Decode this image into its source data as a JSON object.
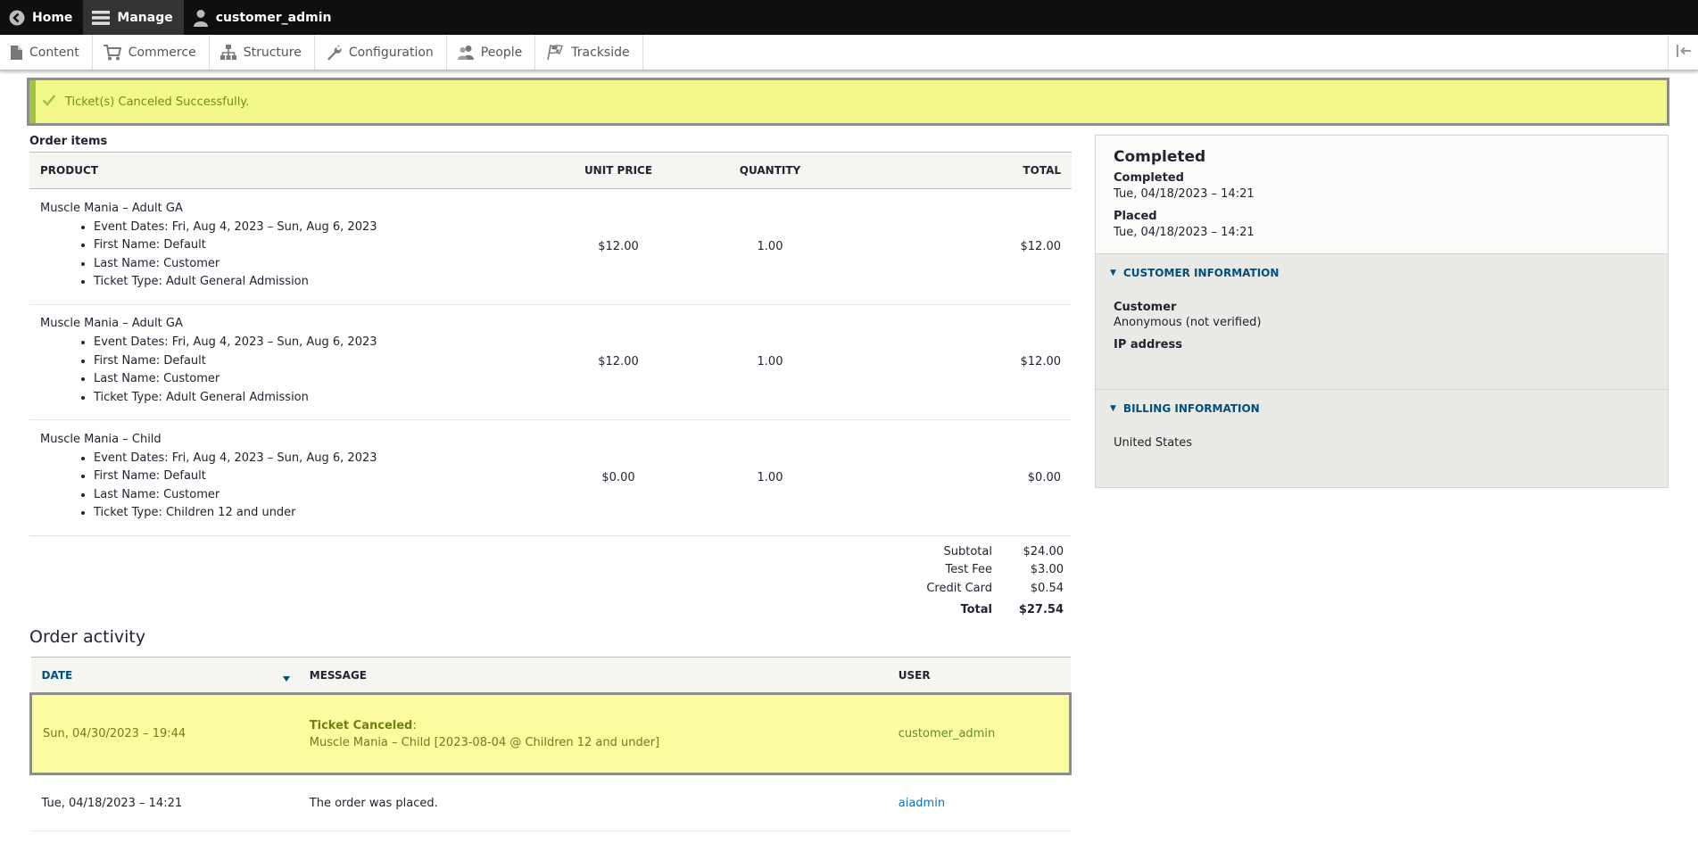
{
  "toolbar": {
    "home_label": "Home",
    "manage_label": "Manage",
    "user_label": "customer_admin"
  },
  "tray": {
    "items": [
      {
        "label": "Content",
        "icon": "document-icon"
      },
      {
        "label": "Commerce",
        "icon": "cart-icon"
      },
      {
        "label": "Structure",
        "icon": "sitemap-icon"
      },
      {
        "label": "Configuration",
        "icon": "wrench-icon"
      },
      {
        "label": "People",
        "icon": "people-icon"
      },
      {
        "label": "Trackside",
        "icon": "checkered-flag-icon"
      }
    ]
  },
  "message": {
    "text": "Ticket(s) Canceled Successfully.",
    "color": "#f3f88d"
  },
  "order_items": {
    "label": "Order items",
    "columns": {
      "product": "Product",
      "unit_price": "Unit price",
      "quantity": "Quantity",
      "total": "Total"
    },
    "rows": [
      {
        "title": "Muscle Mania – Adult GA",
        "attrs": [
          "Event Dates: Fri, Aug 4, 2023 – Sun, Aug 6, 2023",
          "First Name: Default",
          "Last Name: Customer",
          "Ticket Type: Adult General Admission"
        ],
        "unit_price": "$12.00",
        "quantity": "1.00",
        "total": "$12.00"
      },
      {
        "title": "Muscle Mania – Adult GA",
        "attrs": [
          "Event Dates: Fri, Aug 4, 2023 – Sun, Aug 6, 2023",
          "First Name: Default",
          "Last Name: Customer",
          "Ticket Type: Adult General Admission"
        ],
        "unit_price": "$12.00",
        "quantity": "1.00",
        "total": "$12.00"
      },
      {
        "title": "Muscle Mania – Child",
        "attrs": [
          "Event Dates: Fri, Aug 4, 2023 – Sun, Aug 6, 2023",
          "First Name: Default",
          "Last Name: Customer",
          "Ticket Type: Children 12 and under"
        ],
        "unit_price": "$0.00",
        "quantity": "1.00",
        "total": "$0.00"
      }
    ],
    "totals": [
      {
        "label": "Subtotal",
        "value": "$24.00"
      },
      {
        "label": "Test Fee",
        "value": "$3.00"
      },
      {
        "label": "Credit Card",
        "value": "$0.54"
      },
      {
        "label": "Total",
        "value": "$27.54"
      }
    ]
  },
  "activity": {
    "title": "Order activity",
    "columns": {
      "date": "Date",
      "message": "Message",
      "user": "User"
    },
    "rows": [
      {
        "date": "Sun, 04/30/2023 – 19:44",
        "message_title": "Ticket Canceled",
        "message_body": "Muscle Mania – Child [2023-08-04 @ Children 12 and under]",
        "user": "customer_admin"
      },
      {
        "date": "Tue, 04/18/2023 – 14:21",
        "message": "The order was placed.",
        "user": "aiadmin"
      }
    ]
  },
  "sidebar": {
    "state": "Completed",
    "completed_label": "Completed",
    "completed_value": "Tue, 04/18/2023 – 14:21",
    "placed_label": "Placed",
    "placed_value": "Tue, 04/18/2023 – 14:21",
    "customer_info": {
      "heading": "Customer information",
      "customer_label": "Customer",
      "customer_value": "Anonymous (not verified)",
      "ip_label": "IP address"
    },
    "billing_info": {
      "heading": "Billing information",
      "country": "United States"
    }
  }
}
